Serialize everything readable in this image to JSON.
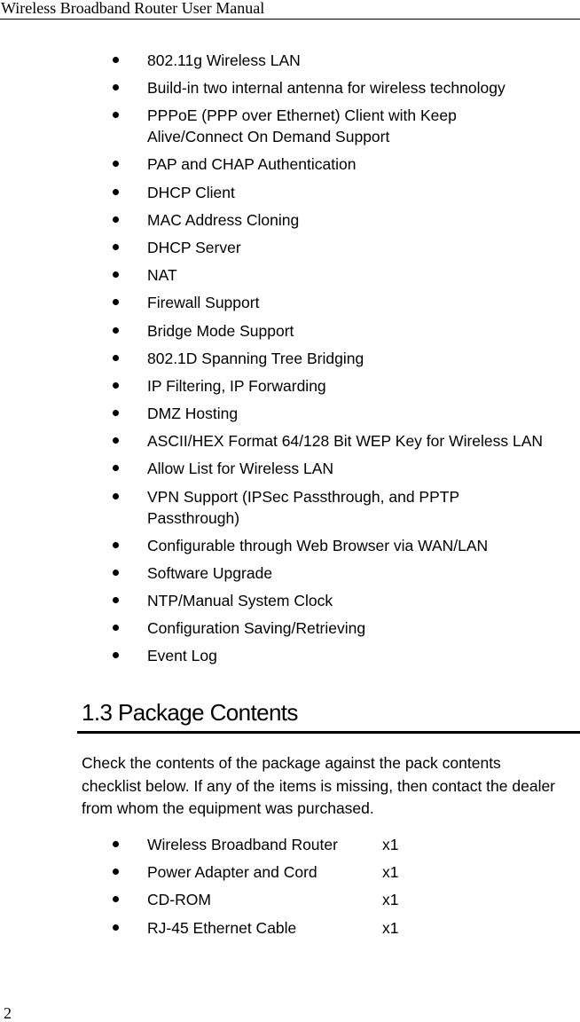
{
  "header": {
    "title": "Wireless Broadband Router User Manual"
  },
  "features": [
    "802.11g Wireless LAN",
    "Build-in two internal antenna for wireless technology",
    "PPPoE (PPP over Ethernet) Client with Keep Alive/Connect On Demand Support",
    "PAP and CHAP Authentication",
    "DHCP Client",
    "MAC Address Cloning",
    "DHCP Server",
    "NAT",
    "Firewall Support",
    "Bridge Mode Support",
    "802.1D Spanning Tree Bridging",
    "IP Filtering, IP Forwarding",
    "DMZ Hosting",
    "ASCII/HEX Format 64/128 Bit WEP Key for Wireless LAN",
    "Allow List for Wireless LAN",
    "VPN Support (IPSec Passthrough, and PPTP Passthrough)",
    "Configurable through Web Browser via WAN/LAN",
    "Software Upgrade",
    "NTP/Manual System Clock",
    "Configuration Saving/Retrieving",
    "Event Log"
  ],
  "features_display": {
    "pppoe_line1": "PPPoE (PPP over Ethernet) Client with Keep",
    "pppoe_line2": "Alive/Connect On Demand Support",
    "vpn_line1": "VPN Support (IPSec Passthrough, and PPTP",
    "vpn_line2": "Passthrough)"
  },
  "section": {
    "heading": "1.3 Package Contents",
    "intro": "Check the contents of the package against the pack contents checklist below. If any of the items is missing, then contact the dealer from whom the equipment was purchased."
  },
  "package_items": [
    {
      "name": "Wireless Broadband Router",
      "qty": "x1"
    },
    {
      "name": "Power Adapter and Cord",
      "qty": "x1"
    },
    {
      "name": "CD-ROM",
      "qty": "x1"
    },
    {
      "name": "RJ-45 Ethernet Cable",
      "qty": "x1"
    }
  ],
  "footer": {
    "page_number": "2"
  }
}
